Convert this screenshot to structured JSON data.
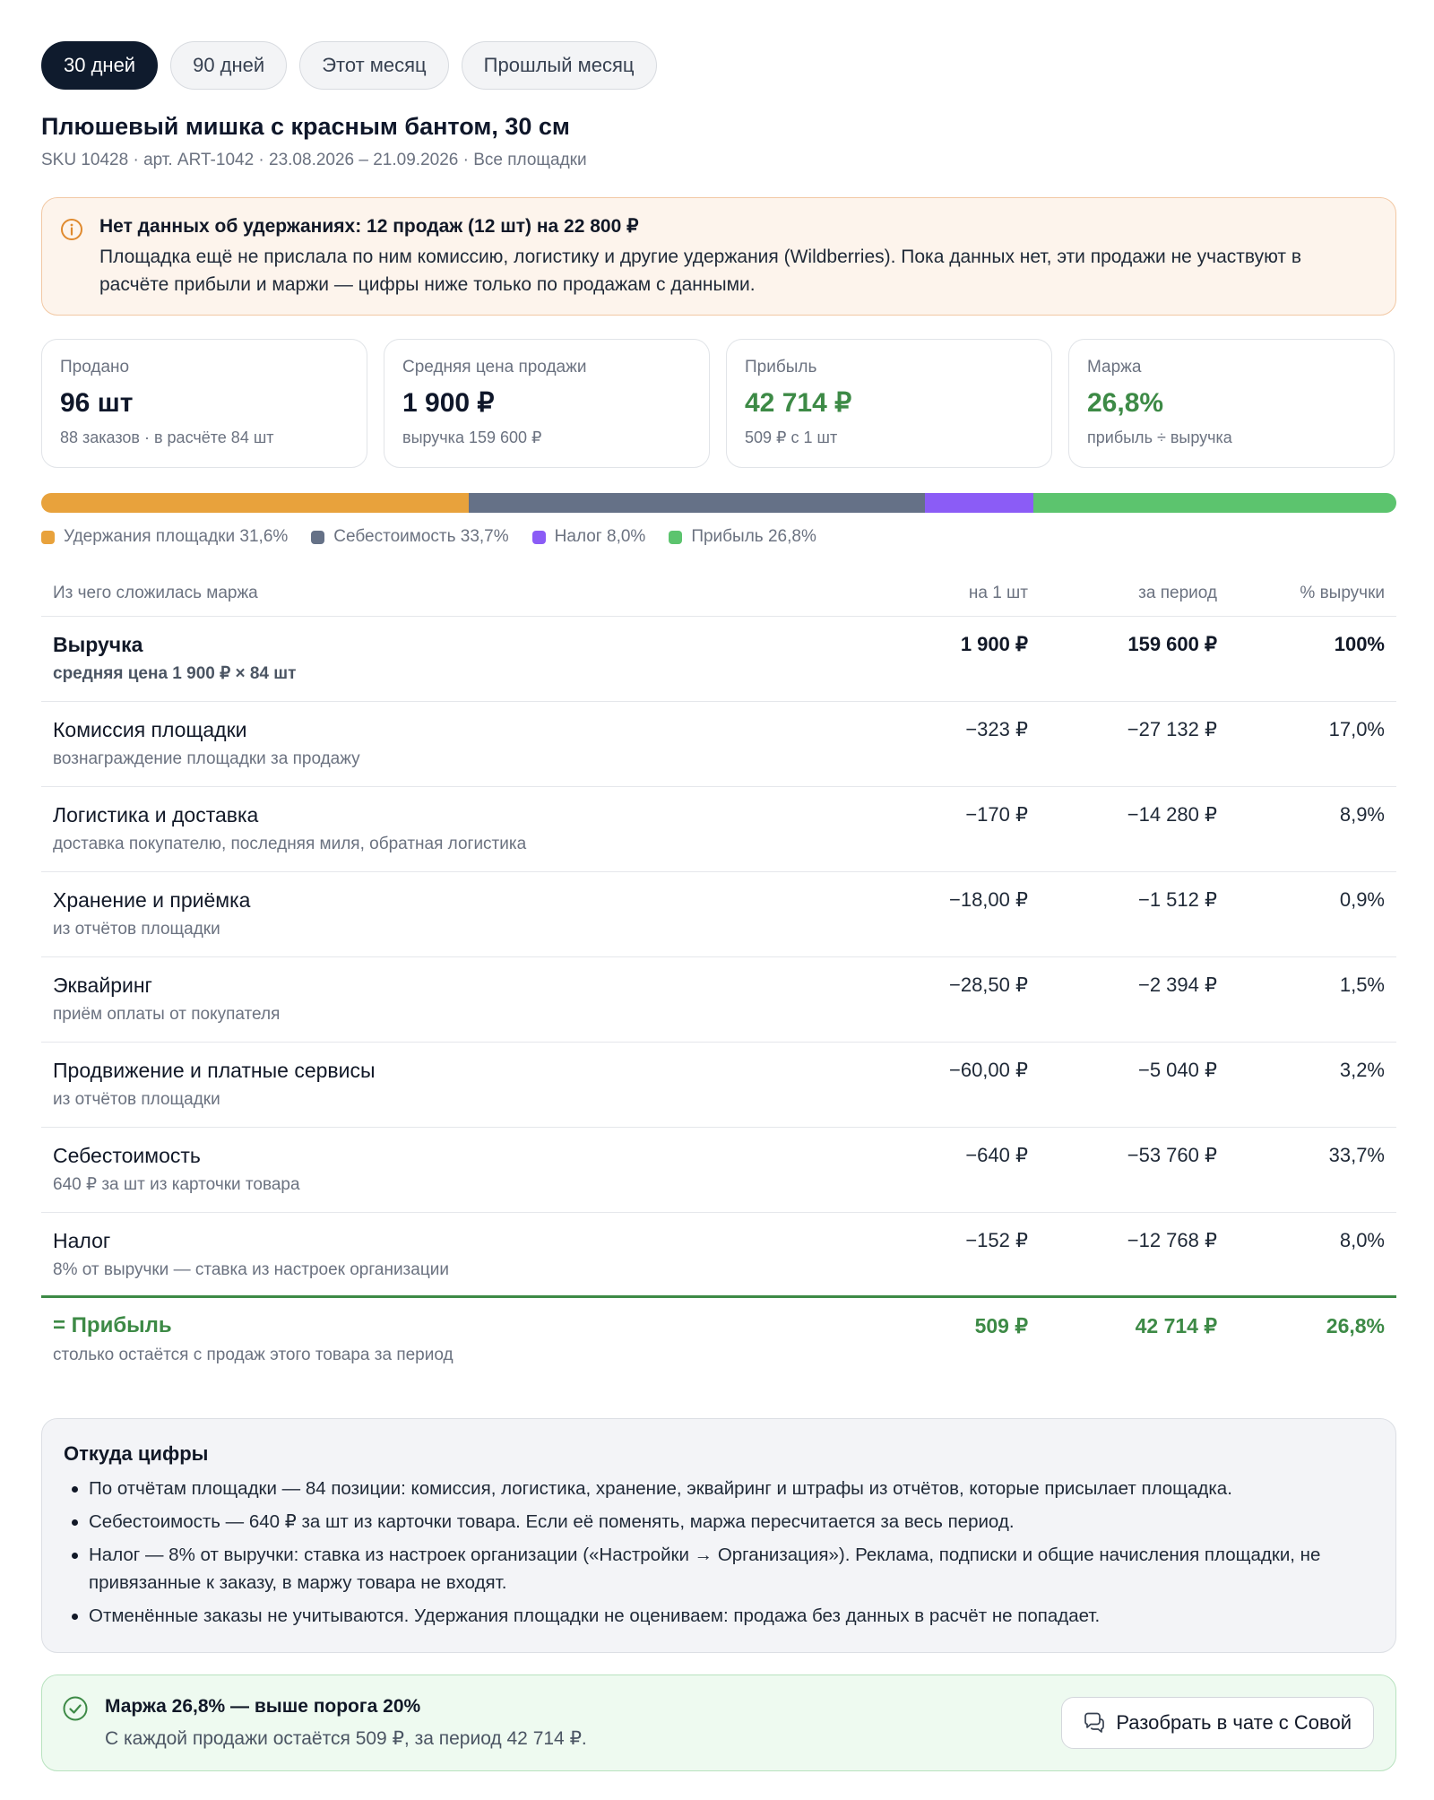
{
  "tabs": [
    {
      "label": "30 дней",
      "active": true
    },
    {
      "label": "90 дней",
      "active": false
    },
    {
      "label": "Этот месяц",
      "active": false
    },
    {
      "label": "Прошлый месяц",
      "active": false
    }
  ],
  "product": {
    "title": "Плюшевый мишка с красным бантом, 30 см",
    "subtitle": "SKU 10428 · арт. ART-1042 · 23.08.2026 – 21.09.2026 · Все площадки"
  },
  "warning": {
    "icon": "info-icon",
    "title": "Нет данных об удержаниях: 12 продаж (12 шт) на 22 800 ₽",
    "text": "Площадка ещё не прислала по ним комиссию, логистику и другие удержания (Wildberries). Пока данных нет, эти продажи не участвуют в расчёте прибыли и маржи — цифры ниже только по продажам с данными."
  },
  "cards": [
    {
      "label": "Продано",
      "value": "96 шт",
      "sub": "88 заказов · в расчёте 84 шт",
      "green": false
    },
    {
      "label": "Средняя цена продажи",
      "value": "1 900 ₽",
      "sub": "выручка 159 600 ₽",
      "green": false
    },
    {
      "label": "Прибыль",
      "value": "42 714 ₽",
      "sub": "509 ₽ с 1 шт",
      "green": true
    },
    {
      "label": "Маржа",
      "value": "26,8%",
      "sub": "прибыль ÷ выручка",
      "green": true
    }
  ],
  "breakdown_bar": {
    "segments": [
      {
        "label": "Удержания площадки 31,6%",
        "percent": 31.6,
        "color": "#e8a23c"
      },
      {
        "label": "Себестоимость 33,7%",
        "percent": 33.7,
        "color": "#657187"
      },
      {
        "label": "Налог 8,0%",
        "percent": 8.0,
        "color": "#8b5cf6"
      },
      {
        "label": "Прибыль 26,8%",
        "percent": 26.8,
        "color": "#5cc46e"
      }
    ]
  },
  "table": {
    "headers": {
      "name": "Из чего сложилась маржа",
      "per_unit": "на 1 шт",
      "period": "за период",
      "pct": "% выручки"
    },
    "rows": [
      {
        "name": "Выручка",
        "sub": "средняя цена 1 900 ₽ × 84 шт",
        "per_unit": "1 900 ₽",
        "period": "159 600 ₽",
        "pct": "100%"
      },
      {
        "name": "Комиссия площадки",
        "sub": "вознаграждение площадки за продажу",
        "per_unit": "−323 ₽",
        "period": "−27 132 ₽",
        "pct": "17,0%"
      },
      {
        "name": "Логистика и доставка",
        "sub": "доставка покупателю, последняя миля, обратная логистика",
        "per_unit": "−170 ₽",
        "period": "−14 280 ₽",
        "pct": "8,9%"
      },
      {
        "name": "Хранение и приёмка",
        "sub": "из отчётов площадки",
        "per_unit": "−18,00 ₽",
        "period": "−1 512 ₽",
        "pct": "0,9%"
      },
      {
        "name": "Эквайринг",
        "sub": "приём оплаты от покупателя",
        "per_unit": "−28,50 ₽",
        "period": "−2 394 ₽",
        "pct": "1,5%"
      },
      {
        "name": "Продвижение и платные сервисы",
        "sub": "из отчётов площадки",
        "per_unit": "−60,00 ₽",
        "period": "−5 040 ₽",
        "pct": "3,2%"
      },
      {
        "name": "Себестоимость",
        "sub": "640 ₽ за шт из карточки товара",
        "per_unit": "−640 ₽",
        "period": "−53 760 ₽",
        "pct": "33,7%"
      },
      {
        "name": "Налог",
        "sub": "8% от выручки — ставка из настроек организации",
        "per_unit": "−152 ₽",
        "period": "−12 768 ₽",
        "pct": "8,0%"
      }
    ],
    "total": {
      "name": "= Прибыль",
      "sub": "столько остаётся с продаж этого товара за период",
      "per_unit": "509 ₽",
      "period": "42 714 ₽",
      "pct": "26,8%"
    }
  },
  "sources": {
    "title": "Откуда цифры",
    "items": [
      "По отчётам площадки — 84 позиции: комиссия, логистика, хранение, эквайринг и штрафы из отчётов, которые присылает площадка.",
      "Себестоимость — 640 ₽ за шт из карточки товара. Если её поменять, маржа пересчитается за весь период.",
      "Налог — 8% от выручки: ставка из настроек организации («Настройки → Организация»). Реклама, подписки и общие начисления площадки, не привязанные к заказу, в маржу товара не входят.",
      "Отменённые заказы не учитываются. Удержания площадки не оцениваем: продажа без данных в расчёт не попадает."
    ]
  },
  "success": {
    "icon": "check-circle-icon",
    "title": "Маржа 26,8% — выше порога 20%",
    "text": "С каждой продажи остаётся 509 ₽, за период 42 714 ₽.",
    "button": {
      "label": "Разобрать в чате с Совой",
      "icon": "chat-bubbles-icon"
    }
  },
  "colors": {
    "accent_dark": "#0f1b2d",
    "profit_green": "#3d8a46",
    "warning_orange": "#e8a23c"
  }
}
